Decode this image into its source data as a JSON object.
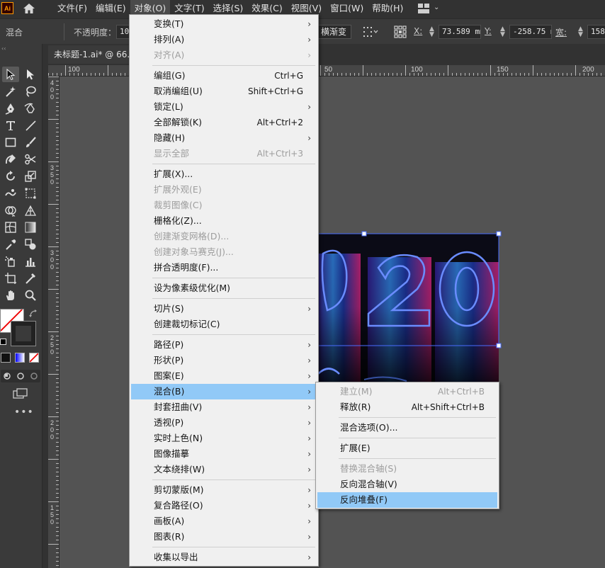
{
  "app": {
    "logo": "Ai"
  },
  "menubar": {
    "items": [
      {
        "label": "文件(F)"
      },
      {
        "label": "编辑(E)"
      },
      {
        "label": "对象(O)",
        "active": true
      },
      {
        "label": "文字(T)"
      },
      {
        "label": "选择(S)"
      },
      {
        "label": "效果(C)"
      },
      {
        "label": "视图(V)"
      },
      {
        "label": "窗口(W)"
      },
      {
        "label": "帮助(H)"
      }
    ]
  },
  "controlbar": {
    "mode": "混合",
    "opacity_label": "不透明度：",
    "opacity_value": "10",
    "gradient_btn": "横渐变",
    "x_label": "X:",
    "x_value": "73.589 mm",
    "y_label": "Y:",
    "y_value": "-258.75 m",
    "w_label": "宽:",
    "w_value": "158."
  },
  "document": {
    "tab_title": "未标题-1.ai* @ 66.",
    "ruler_h": [
      "100",
      "50",
      "100",
      "150",
      "200"
    ],
    "ruler_v": [
      "4\n0\n0",
      "3\n5\n0",
      "3\n0\n0",
      "2\n5\n0",
      "2\n0\n0",
      "1\n5\n0"
    ]
  },
  "object_menu": {
    "items": [
      {
        "label": "变换(T)",
        "submenu": true
      },
      {
        "label": "排列(A)",
        "submenu": true
      },
      {
        "label": "对齐(A)",
        "submenu": true,
        "disabled": true
      },
      {
        "sep": true
      },
      {
        "label": "编组(G)",
        "shortcut": "Ctrl+G"
      },
      {
        "label": "取消编组(U)",
        "shortcut": "Shift+Ctrl+G"
      },
      {
        "label": "锁定(L)",
        "submenu": true
      },
      {
        "label": "全部解锁(K)",
        "shortcut": "Alt+Ctrl+2"
      },
      {
        "label": "隐藏(H)",
        "submenu": true
      },
      {
        "label": "显示全部",
        "shortcut": "Alt+Ctrl+3",
        "disabled": true
      },
      {
        "sep": true
      },
      {
        "label": "扩展(X)..."
      },
      {
        "label": "扩展外观(E)",
        "disabled": true
      },
      {
        "label": "裁剪图像(C)",
        "disabled": true
      },
      {
        "label": "栅格化(Z)..."
      },
      {
        "label": "创建渐变网格(D)...",
        "disabled": true
      },
      {
        "label": "创建对象马赛克(J)...",
        "disabled": true
      },
      {
        "label": "拼合透明度(F)..."
      },
      {
        "sep": true
      },
      {
        "label": "设为像素级优化(M)"
      },
      {
        "sep": true
      },
      {
        "label": "切片(S)",
        "submenu": true
      },
      {
        "label": "创建裁切标记(C)"
      },
      {
        "sep": true
      },
      {
        "label": "路径(P)",
        "submenu": true
      },
      {
        "label": "形状(P)",
        "submenu": true
      },
      {
        "label": "图案(E)",
        "submenu": true
      },
      {
        "label": "混合(B)",
        "submenu": true,
        "highlighted": true
      },
      {
        "label": "封套扭曲(V)",
        "submenu": true
      },
      {
        "label": "透视(P)",
        "submenu": true
      },
      {
        "label": "实时上色(N)",
        "submenu": true
      },
      {
        "label": "图像描摹",
        "submenu": true
      },
      {
        "label": "文本绕排(W)",
        "submenu": true
      },
      {
        "sep": true
      },
      {
        "label": "剪切蒙版(M)",
        "submenu": true
      },
      {
        "label": "复合路径(O)",
        "submenu": true
      },
      {
        "label": "画板(A)",
        "submenu": true
      },
      {
        "label": "图表(R)",
        "submenu": true
      },
      {
        "sep": true
      },
      {
        "label": "收集以导出",
        "submenu": true
      }
    ]
  },
  "blend_submenu": {
    "items": [
      {
        "label": "建立(M)",
        "shortcut": "Alt+Ctrl+B",
        "disabled": true
      },
      {
        "label": "释放(R)",
        "shortcut": "Alt+Shift+Ctrl+B"
      },
      {
        "sep": true
      },
      {
        "label": "混合选项(O)..."
      },
      {
        "sep": true
      },
      {
        "label": "扩展(E)"
      },
      {
        "sep": true
      },
      {
        "label": "替换混合轴(S)",
        "disabled": true
      },
      {
        "label": "反向混合轴(V)"
      },
      {
        "label": "反向堆叠(F)",
        "highlighted": true
      }
    ]
  },
  "colors": {
    "menu_bg": "#f0f0f0",
    "menu_highlight": "#91c9f7",
    "ui_dark": "#323232",
    "canvas": "#535353",
    "logo_orange": "#ff9a00"
  },
  "icons": [
    "home-icon",
    "workspace-icon",
    "selection-tool-icon",
    "direct-selection-tool-icon",
    "magic-wand-icon",
    "lasso-icon",
    "pen-icon",
    "curvature-icon",
    "type-icon",
    "line-icon",
    "rectangle-icon",
    "paintbrush-icon",
    "shaper-icon",
    "scissors-icon",
    "rotate-icon",
    "scale-icon",
    "warp-icon",
    "free-transform-icon",
    "shape-builder-icon",
    "perspective-grid-icon",
    "mesh-icon",
    "gradient-icon",
    "eyedropper-icon",
    "blend-icon",
    "symbol-sprayer-icon",
    "column-graph-icon",
    "artboard-icon",
    "slice-icon",
    "hand-icon",
    "zoom-icon",
    "swap-icon",
    "more-tools-icon"
  ]
}
